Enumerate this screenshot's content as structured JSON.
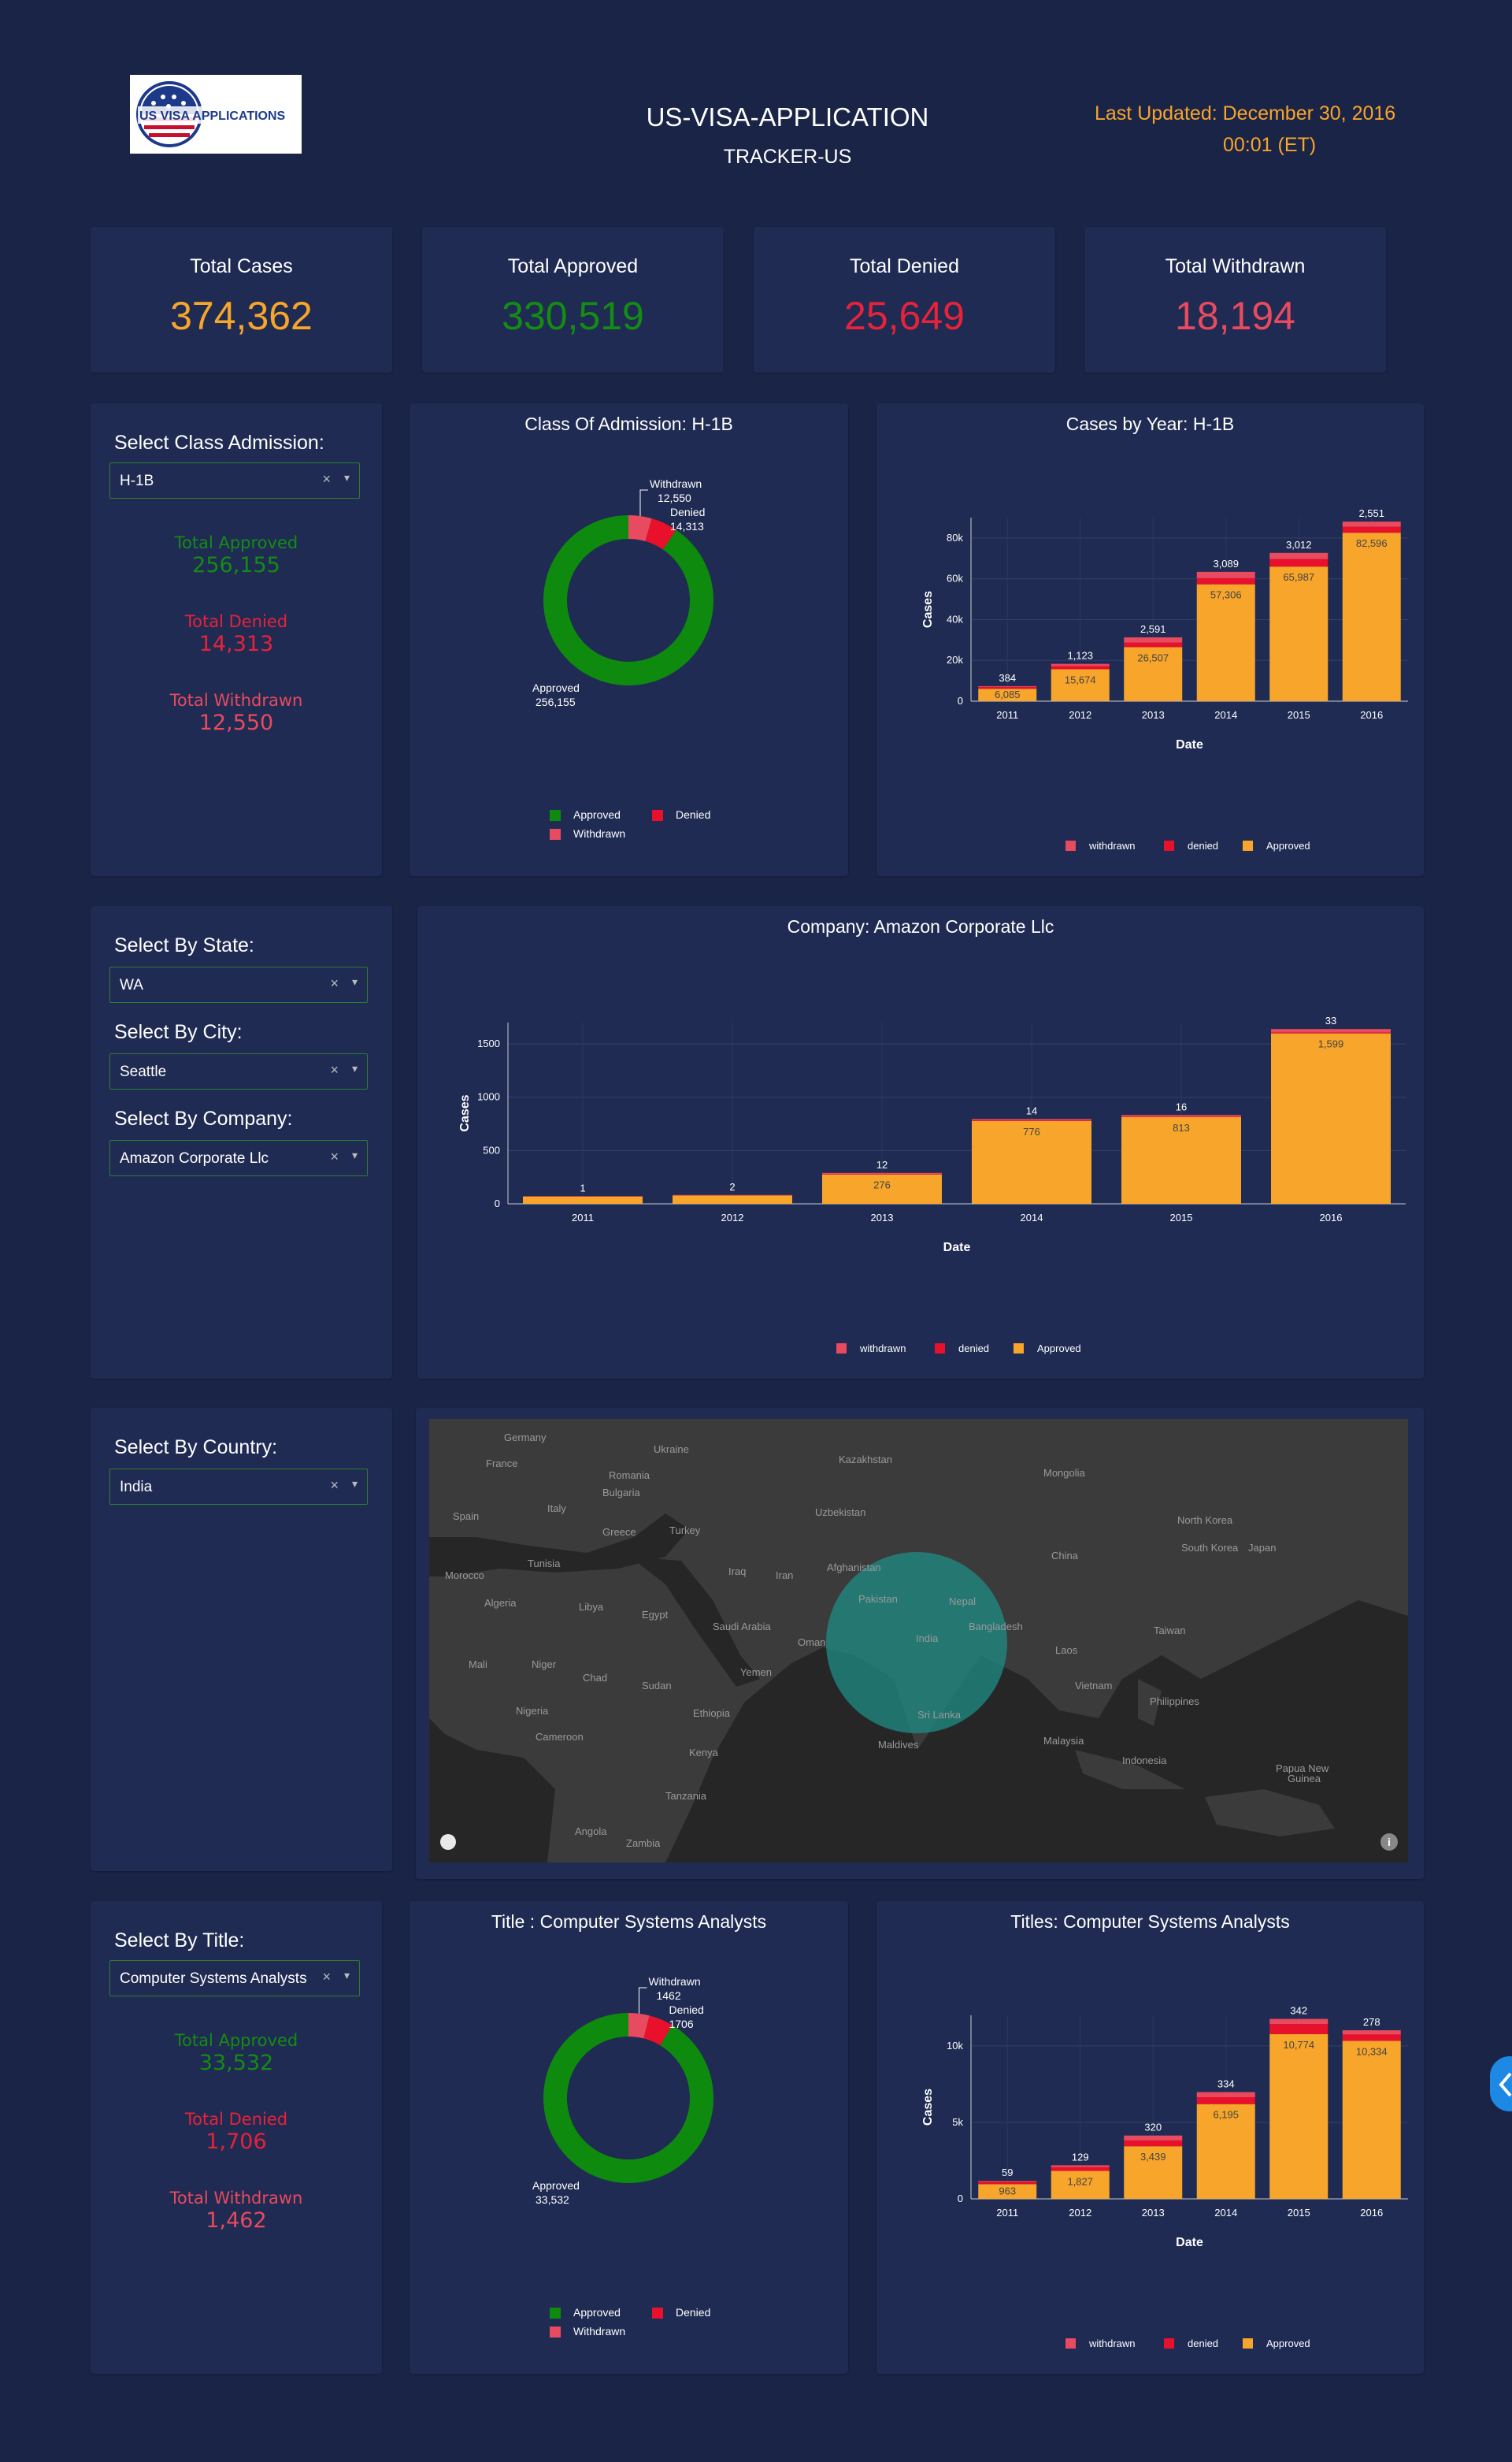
{
  "header": {
    "logo_text": "US VISA APPLICATIONS",
    "title": "US-VISA-APPLICATION",
    "subtitle": "TRACKER-US",
    "last_updated_line1": "Last Updated: December 30, 2016",
    "last_updated_line2": "00:01 (ET)"
  },
  "colors": {
    "approved": "#f7a52b",
    "approved_green": "#0e8a0e",
    "denied": "#e8102a",
    "withdrawn": "#e84a5f",
    "total": "#f7a52b",
    "bg": "#1a2447",
    "card": "#1f2b52"
  },
  "kpis": [
    {
      "label": "Total Cases",
      "value": "374,362",
      "color": "#f7a52b"
    },
    {
      "label": "Total Approved",
      "value": "330,519",
      "color": "#148c14"
    },
    {
      "label": "Total Denied",
      "value": "25,649",
      "color": "#e8223a"
    },
    {
      "label": "Total Withdrawn",
      "value": "18,194",
      "color": "#e84a5f"
    }
  ],
  "class_panel": {
    "label": "Select Class Admission:",
    "value": "H-1B",
    "clear": "×",
    "caret": "▾",
    "approved_label": "Total Approved",
    "approved_value": "256,155",
    "denied_label": "Total Denied",
    "denied_value": "14,313",
    "withdrawn_label": "Total Withdrawn",
    "withdrawn_value": "12,550"
  },
  "filters": {
    "state_label": "Select By State:",
    "state_value": "WA",
    "city_label": "Select By City:",
    "city_value": "Seattle",
    "company_label": "Select By Company:",
    "company_value": "Amazon Corporate Llc",
    "country_label": "Select By Country:",
    "country_value": "India",
    "clear": "×",
    "caret": "▾"
  },
  "title_panel": {
    "label": "Select By Title:",
    "value": "Computer Systems Analysts",
    "clear": "×",
    "caret": "▾",
    "approved_label": "Total Approved",
    "approved_value": "33,532",
    "denied_label": "Total Denied",
    "denied_value": "1,706",
    "withdrawn_label": "Total Withdrawn",
    "withdrawn_value": "1,462"
  },
  "map": {
    "labels": [
      {
        "t": "Germany",
        "x": 75,
        "y": 10
      },
      {
        "t": "Ukraine",
        "x": 265,
        "y": 25
      },
      {
        "t": "Kazakhstan",
        "x": 500,
        "y": 38
      },
      {
        "t": "Mongolia",
        "x": 760,
        "y": 55
      },
      {
        "t": "France",
        "x": 52,
        "y": 43
      },
      {
        "t": "Romania",
        "x": 208,
        "y": 58
      },
      {
        "t": "Bulgaria",
        "x": 200,
        "y": 80
      },
      {
        "t": "Spain",
        "x": 10,
        "y": 110
      },
      {
        "t": "Italy",
        "x": 130,
        "y": 100
      },
      {
        "t": "Greece",
        "x": 200,
        "y": 130
      },
      {
        "t": "Turkey",
        "x": 285,
        "y": 128
      },
      {
        "t": "Uzbekistan",
        "x": 470,
        "y": 105
      },
      {
        "t": "North Korea",
        "x": 930,
        "y": 115
      },
      {
        "t": "South Korea",
        "x": 935,
        "y": 150
      },
      {
        "t": "Japan",
        "x": 1020,
        "y": 150
      },
      {
        "t": "China",
        "x": 770,
        "y": 160
      },
      {
        "t": "Afghanistan",
        "x": 485,
        "y": 175
      },
      {
        "t": "Iran",
        "x": 420,
        "y": 185
      },
      {
        "t": "Iraq",
        "x": 360,
        "y": 180
      },
      {
        "t": "Tunisia",
        "x": 105,
        "y": 170
      },
      {
        "t": "Morocco",
        "x": 0,
        "y": 185
      },
      {
        "t": "Pakistan",
        "x": 525,
        "y": 215
      },
      {
        "t": "Nepal",
        "x": 640,
        "y": 218
      },
      {
        "t": "Algeria",
        "x": 50,
        "y": 220
      },
      {
        "t": "Libya",
        "x": 170,
        "y": 225
      },
      {
        "t": "Egypt",
        "x": 250,
        "y": 235
      },
      {
        "t": "Saudi Arabia",
        "x": 340,
        "y": 250
      },
      {
        "t": "Bangladesh",
        "x": 665,
        "y": 250
      },
      {
        "t": "India",
        "x": 598,
        "y": 265
      },
      {
        "t": "Taiwan",
        "x": 900,
        "y": 255
      },
      {
        "t": "Oman",
        "x": 448,
        "y": 270
      },
      {
        "t": "Laos",
        "x": 775,
        "y": 280
      },
      {
        "t": "Mali",
        "x": 30,
        "y": 298
      },
      {
        "t": "Niger",
        "x": 110,
        "y": 298
      },
      {
        "t": "Chad",
        "x": 175,
        "y": 315
      },
      {
        "t": "Sudan",
        "x": 250,
        "y": 325
      },
      {
        "t": "Yemen",
        "x": 375,
        "y": 308
      },
      {
        "t": "Vietnam",
        "x": 800,
        "y": 325
      },
      {
        "t": "Philippines",
        "x": 895,
        "y": 345
      },
      {
        "t": "Nigeria",
        "x": 90,
        "y": 357
      },
      {
        "t": "Ethiopia",
        "x": 315,
        "y": 360
      },
      {
        "t": "Sri Lanka",
        "x": 600,
        "y": 362
      },
      {
        "t": "Cameroon",
        "x": 115,
        "y": 390
      },
      {
        "t": "Malaysia",
        "x": 760,
        "y": 395
      },
      {
        "t": "Maldives",
        "x": 550,
        "y": 400
      },
      {
        "t": "Kenya",
        "x": 310,
        "y": 410
      },
      {
        "t": "Indonesia",
        "x": 860,
        "y": 420
      },
      {
        "t": "Papua New",
        "x": 1055,
        "y": 430
      },
      {
        "t": "Guinea",
        "x": 1070,
        "y": 443
      },
      {
        "t": "Tanzania",
        "x": 280,
        "y": 465
      },
      {
        "t": "Angola",
        "x": 165,
        "y": 510
      },
      {
        "t": "Zambia",
        "x": 230,
        "y": 525
      }
    ]
  },
  "chart_data": [
    {
      "type": "pie",
      "title": "Class Of Admission: H-1B",
      "labels": [
        "Approved",
        "Withdrawn",
        "Denied"
      ],
      "values": [
        256155,
        12550,
        14313
      ],
      "value_labels": [
        "256,155",
        "12,550",
        "14,313"
      ],
      "colors": [
        "#0e8a0e",
        "#e84a5f",
        "#e8102a"
      ],
      "legend": [
        "Approved",
        "Denied",
        "Withdrawn"
      ]
    },
    {
      "type": "bar",
      "title": "Cases by Year: H-1B",
      "xlabel": "Date",
      "ylabel": "Cases",
      "categories": [
        "2011",
        "2012",
        "2013",
        "2014",
        "2015",
        "2016"
      ],
      "ylim": [
        0,
        90000
      ],
      "yticks": [
        0,
        20000,
        40000,
        60000,
        80000
      ],
      "ytick_labels": [
        "0",
        "20k",
        "40k",
        "60k",
        "80k"
      ],
      "series": [
        {
          "name": "Approved",
          "values": [
            6085,
            15674,
            26507,
            57306,
            65987,
            82596
          ],
          "labels": [
            "6,085",
            "15,674",
            "26,507",
            "57,306",
            "65,987",
            "82,596"
          ]
        },
        {
          "name": "denied",
          "values": [
            900,
            1500,
            2200,
            3000,
            3700,
            2900
          ],
          "labels": [
            "",
            "",
            "",
            "",
            "",
            ""
          ]
        },
        {
          "name": "withdrawn",
          "values": [
            384,
            1123,
            2591,
            3089,
            3012,
            2551
          ],
          "labels": [
            "384",
            "1,123",
            "2,591",
            "3,089",
            "3,012",
            "2,551"
          ]
        }
      ],
      "legend": [
        "withdrawn",
        "denied",
        "Approved"
      ]
    },
    {
      "type": "bar",
      "title": "Company: Amazon Corporate Llc",
      "xlabel": "Date",
      "ylabel": "Cases",
      "categories": [
        "2011",
        "2012",
        "2013",
        "2014",
        "2015",
        "2016"
      ],
      "ylim": [
        0,
        1700
      ],
      "yticks": [
        0,
        500,
        1000,
        1500
      ],
      "ytick_labels": [
        "0",
        "500",
        "1000",
        "1500"
      ],
      "series": [
        {
          "name": "Approved",
          "values": [
            70,
            80,
            276,
            776,
            813,
            1599
          ],
          "labels": [
            "",
            "",
            "276",
            "776",
            "813",
            "1,599"
          ]
        },
        {
          "name": "denied",
          "values": [
            1,
            1,
            2,
            5,
            4,
            8
          ],
          "labels": [
            "",
            "",
            "",
            "",
            "",
            ""
          ]
        },
        {
          "name": "withdrawn",
          "values": [
            1,
            2,
            12,
            14,
            16,
            33
          ],
          "labels": [
            "1",
            "2",
            "12",
            "14",
            "16",
            "33"
          ]
        }
      ],
      "legend": [
        "withdrawn",
        "denied",
        "Approved"
      ]
    },
    {
      "type": "pie",
      "title": "Title : Computer Systems Analysts",
      "labels": [
        "Approved",
        "Withdrawn",
        "Denied"
      ],
      "values": [
        33532,
        1462,
        1706
      ],
      "value_labels": [
        "33,532",
        "1462",
        "1706"
      ],
      "colors": [
        "#0e8a0e",
        "#e84a5f",
        "#e8102a"
      ],
      "legend": [
        "Approved",
        "Denied",
        "Withdrawn"
      ]
    },
    {
      "type": "bar",
      "title": "Titles: Computer Systems Analysts",
      "xlabel": "Date",
      "ylabel": "Cases",
      "categories": [
        "2011",
        "2012",
        "2013",
        "2014",
        "2015",
        "2016"
      ],
      "ylim": [
        0,
        12000
      ],
      "yticks": [
        0,
        5000,
        10000
      ],
      "ytick_labels": [
        "0",
        "5k",
        "10k"
      ],
      "series": [
        {
          "name": "Approved",
          "values": [
            963,
            1827,
            3439,
            6195,
            10774,
            10334
          ],
          "labels": [
            "963",
            "1,827",
            "3,439",
            "6,195",
            "10,774",
            "10,334"
          ]
        },
        {
          "name": "denied",
          "values": [
            150,
            240,
            380,
            450,
            650,
            410
          ],
          "labels": [
            "",
            "",
            "",
            "",
            "",
            ""
          ]
        },
        {
          "name": "withdrawn",
          "values": [
            59,
            129,
            320,
            334,
            342,
            278
          ],
          "labels": [
            "59",
            "129",
            "320",
            "334",
            "342",
            "278"
          ]
        }
      ],
      "legend": [
        "withdrawn",
        "denied",
        "Approved"
      ]
    }
  ]
}
